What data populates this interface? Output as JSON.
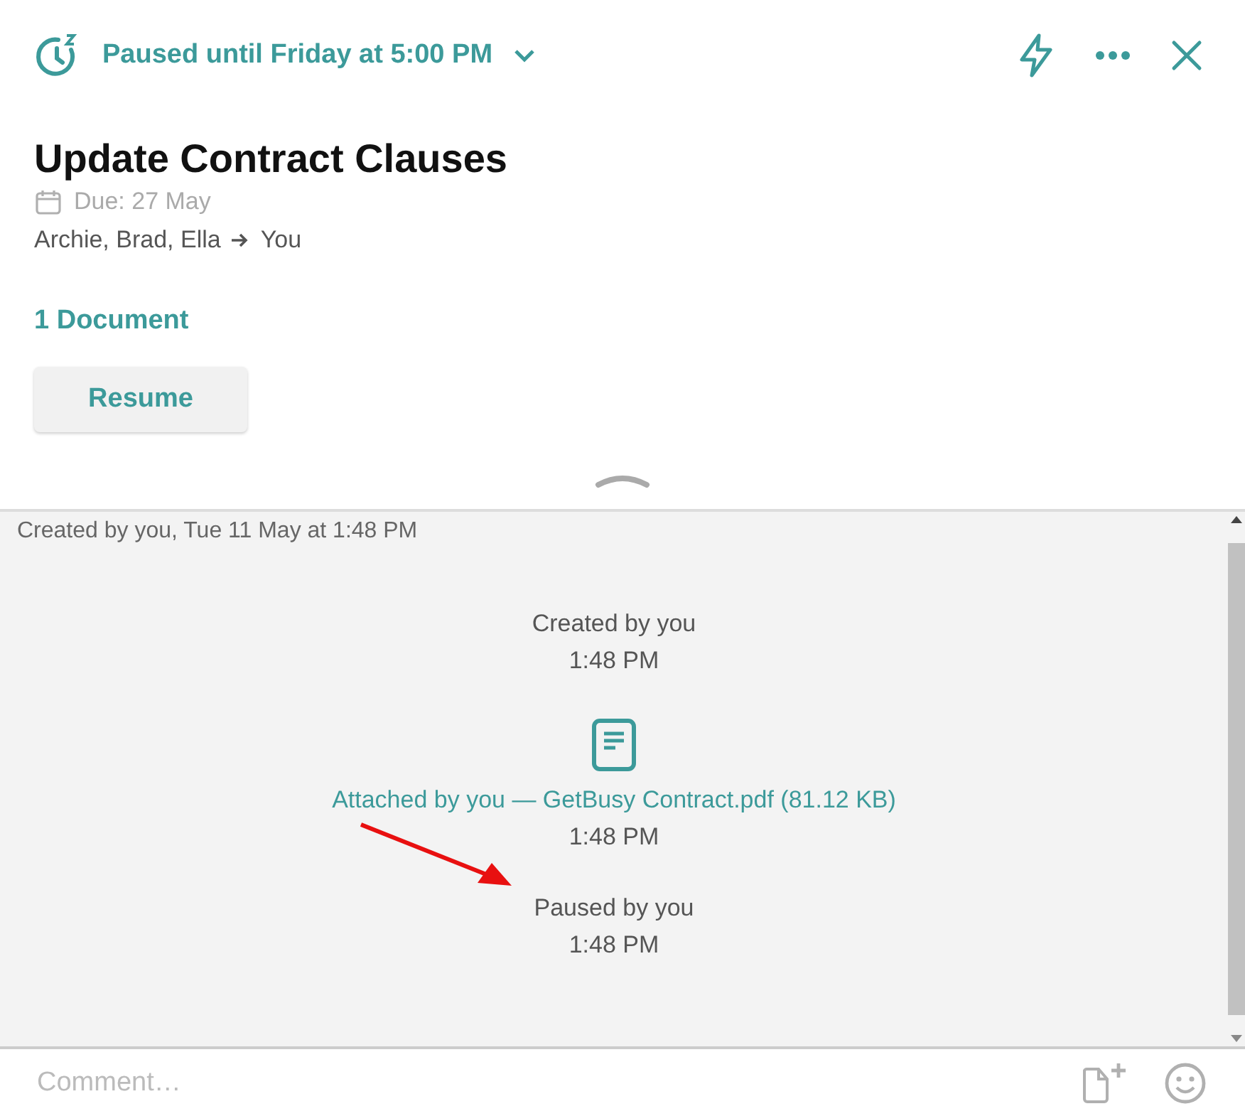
{
  "status": {
    "label": "Paused until Friday at 5:00 PM"
  },
  "task": {
    "title": "Update Contract Clauses",
    "due": "Due: 27 May",
    "from": "Archie, Brad, Ella",
    "to": "You"
  },
  "documents_link": "1 Document",
  "resume_button": "Resume",
  "activity": {
    "header": "Created by you, Tue 11 May at 1:48 PM",
    "items": [
      {
        "kind": "event",
        "text": "Created by you",
        "time": "1:48 PM"
      },
      {
        "kind": "attachment",
        "text": "Attached by you — GetBusy Contract.pdf (81.12 KB)",
        "time": "1:48 PM"
      },
      {
        "kind": "event",
        "text": "Paused by you",
        "time": "1:48 PM",
        "highlighted": true
      }
    ]
  },
  "comment": {
    "placeholder": "Comment…"
  }
}
